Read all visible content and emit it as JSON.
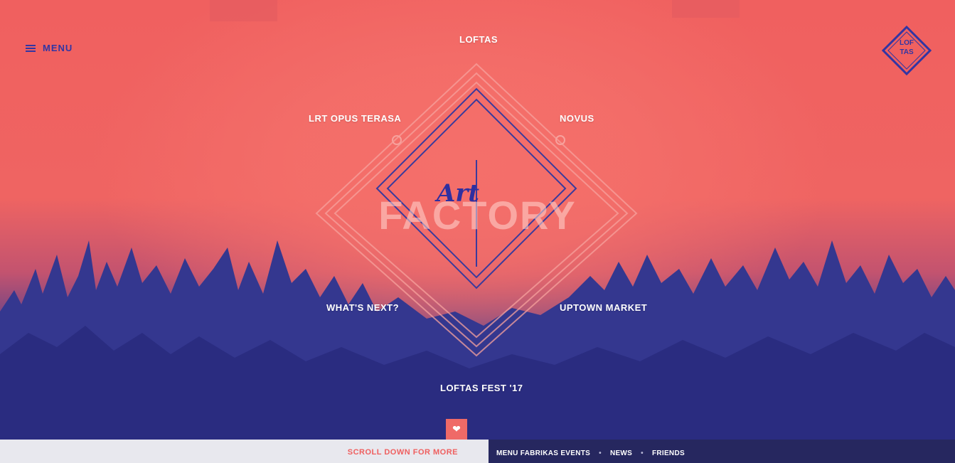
{
  "header": {
    "menu_label": "MENU",
    "brand_logo_lines": [
      "LOF",
      "TAS"
    ]
  },
  "center_logo": {
    "script_word": "Art",
    "block_word": "FACTORY"
  },
  "nav_links": {
    "top": "LOFTAS",
    "upper_left": "LRT OPUS TERASA",
    "upper_right": "NOVUS",
    "lower_left": "WHAT'S NEXT?",
    "lower_right": "UPTOWN MARKET",
    "bottom": "LOFTAS FEST '17"
  },
  "scroll": {
    "label": "SCROLL DOWN FOR MORE",
    "icon": "heart-icon"
  },
  "footer": {
    "links": [
      "MENU FABRIKAS EVENTS",
      "NEWS",
      "FRIENDS"
    ],
    "separator": "•"
  },
  "colors": {
    "accent_red": "#ef6a67",
    "navy": "#2e2f8a",
    "menu_blue": "#3235a3"
  }
}
